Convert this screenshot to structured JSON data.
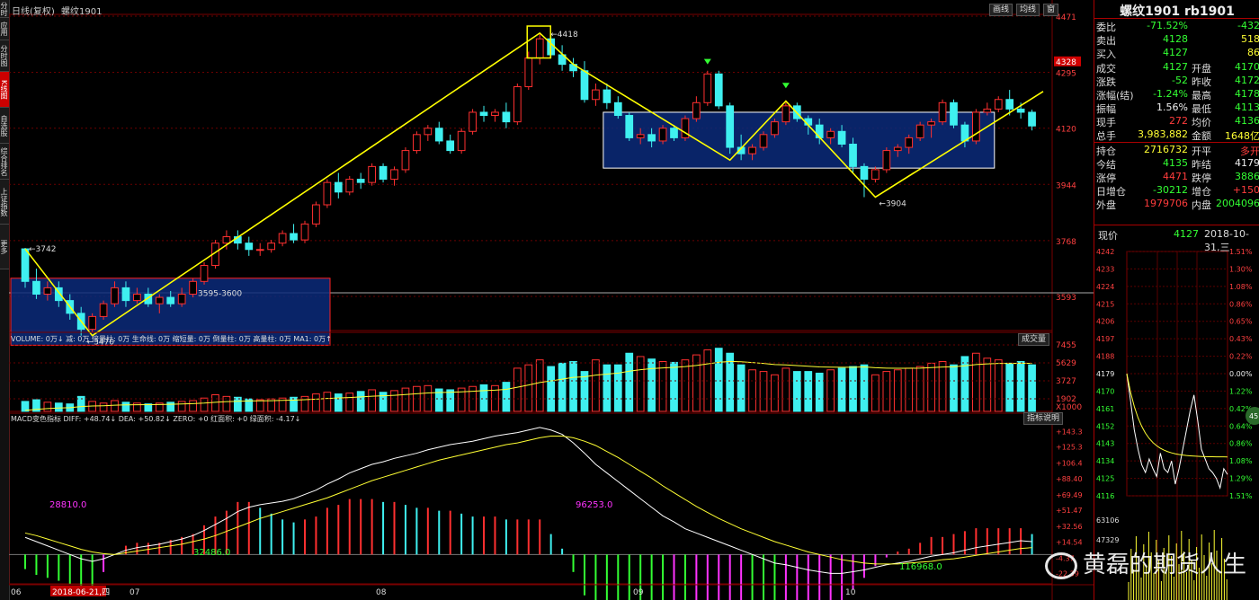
{
  "app": {
    "left_tabs": [
      "分时图",
      "应用",
      "分时图",
      "K线图",
      "自选股",
      "综合排名",
      "上证指数",
      "更多"
    ],
    "chart_title": "日线(复权)",
    "symbol_name": "螺纹1901",
    "top_buttons": [
      "画线",
      "均线",
      "窗"
    ],
    "volume_button": "成交量",
    "macd_button": "指标说明"
  },
  "info": {
    "title": "螺纹1901 rb1901",
    "rows": [
      {
        "l": "委比",
        "v": "-71.52%",
        "vc": "green",
        "l2": "",
        "v2": "-432",
        "v2c": "green"
      },
      {
        "l": "卖出",
        "v": "4128",
        "vc": "green",
        "l2": "",
        "v2": "518",
        "v2c": "yellow"
      },
      {
        "l": "买入",
        "v": "4127",
        "vc": "green",
        "l2": "",
        "v2": "86",
        "v2c": "yellow"
      },
      {
        "l": "成交",
        "v": "4127",
        "vc": "green",
        "l2": "开盘",
        "v2": "4170",
        "v2c": "green"
      },
      {
        "l": "涨跌",
        "v": "-52",
        "vc": "green",
        "l2": "昨收",
        "v2": "4172",
        "v2c": "green"
      },
      {
        "l": "涨幅(结)",
        "v": "-1.24%",
        "vc": "green",
        "l2": "最高",
        "v2": "4178",
        "v2c": "green"
      },
      {
        "l": "振幅",
        "v": "1.56%",
        "vc": "white",
        "l2": "最低",
        "v2": "4113",
        "v2c": "green"
      },
      {
        "l": "现手",
        "v": "272",
        "vc": "red",
        "l2": "均价",
        "v2": "4136",
        "v2c": "green"
      },
      {
        "l": "总手",
        "v": "3,983,882",
        "vc": "yellow",
        "l2": "金额",
        "v2": "1648亿",
        "v2c": "yellow"
      },
      {
        "l": "持仓",
        "v": "2716732",
        "vc": "yellow",
        "l2": "开平",
        "v2": "多开",
        "v2c": "red"
      },
      {
        "l": "今结",
        "v": "4135",
        "vc": "green",
        "l2": "昨结",
        "v2": "4179",
        "v2c": "white"
      },
      {
        "l": "涨停",
        "v": "4471",
        "vc": "red",
        "l2": "跌停",
        "v2": "3886",
        "v2c": "green"
      },
      {
        "l": "日增仓",
        "v": "-30212",
        "vc": "green",
        "l2": "增仓",
        "v2": "+150",
        "v2c": "red"
      },
      {
        "l": "外盘",
        "v": "1979706",
        "vc": "red",
        "l2": "内盘",
        "v2": "2004096",
        "v2c": "green"
      }
    ],
    "xianjia_label": "现价",
    "xianjia_value": "4127",
    "date_label": "2018-10-31,三",
    "minute_left_ticks": [
      "4242",
      "4233",
      "4224",
      "4215",
      "4206",
      "4197",
      "4188",
      "4179",
      "4170",
      "4161",
      "4152",
      "4143",
      "4134",
      "4125",
      "4116"
    ],
    "minute_right_ticks": [
      "1.51%",
      "1.30%",
      "1.08%",
      "0.86%",
      "0.65%",
      "0.43%",
      "0.22%",
      "0.00%",
      "1.22%",
      "0.42%",
      "0.64%",
      "0.86%",
      "1.08%",
      "1.29%",
      "1.51%"
    ],
    "minute_vol_ticks": [
      "63106",
      "47329"
    ],
    "minute_badge": "45"
  },
  "chart_data": {
    "type": "candlestick",
    "price_axis_ticks": [
      "4471",
      "4295",
      "4120",
      "3944",
      "3768",
      "3593"
    ],
    "price_tag": "4328",
    "annotations": {
      "low1": "3742",
      "low2": "3470",
      "high": "4418",
      "low3": "3904",
      "zone": "3595-3600"
    },
    "x_labels": [
      "06",
      "2018-06-21,四",
      "07",
      "08",
      "09",
      "10"
    ],
    "candles": [
      [
        3742,
        3745,
        3620,
        3640
      ],
      [
        3640,
        3680,
        3585,
        3600
      ],
      [
        3600,
        3640,
        3580,
        3620
      ],
      [
        3620,
        3640,
        3560,
        3580
      ],
      [
        3580,
        3600,
        3520,
        3540
      ],
      [
        3540,
        3560,
        3470,
        3490
      ],
      [
        3490,
        3540,
        3480,
        3530
      ],
      [
        3530,
        3580,
        3520,
        3570
      ],
      [
        3570,
        3640,
        3560,
        3620
      ],
      [
        3620,
        3640,
        3560,
        3580
      ],
      [
        3580,
        3620,
        3570,
        3600
      ],
      [
        3600,
        3620,
        3560,
        3570
      ],
      [
        3570,
        3600,
        3540,
        3590
      ],
      [
        3590,
        3610,
        3560,
        3570
      ],
      [
        3570,
        3620,
        3560,
        3600
      ],
      [
        3600,
        3650,
        3590,
        3640
      ],
      [
        3640,
        3700,
        3630,
        3690
      ],
      [
        3690,
        3770,
        3680,
        3760
      ],
      [
        3760,
        3800,
        3740,
        3780
      ],
      [
        3780,
        3800,
        3740,
        3760
      ],
      [
        3760,
        3780,
        3720,
        3740
      ],
      [
        3740,
        3760,
        3720,
        3740
      ],
      [
        3740,
        3770,
        3730,
        3760
      ],
      [
        3760,
        3800,
        3750,
        3790
      ],
      [
        3790,
        3820,
        3760,
        3770
      ],
      [
        3770,
        3830,
        3760,
        3820
      ],
      [
        3820,
        3890,
        3810,
        3880
      ],
      [
        3880,
        3960,
        3870,
        3950
      ],
      [
        3950,
        3980,
        3900,
        3920
      ],
      [
        3920,
        3970,
        3910,
        3960
      ],
      [
        3960,
        3980,
        3930,
        3950
      ],
      [
        3950,
        4010,
        3940,
        4000
      ],
      [
        4000,
        4010,
        3950,
        3960
      ],
      [
        3960,
        4000,
        3940,
        3990
      ],
      [
        3990,
        4060,
        3980,
        4050
      ],
      [
        4050,
        4110,
        4040,
        4100
      ],
      [
        4100,
        4130,
        4080,
        4120
      ],
      [
        4120,
        4140,
        4070,
        4080
      ],
      [
        4080,
        4100,
        4040,
        4050
      ],
      [
        4050,
        4120,
        4040,
        4110
      ],
      [
        4110,
        4180,
        4100,
        4170
      ],
      [
        4170,
        4190,
        4140,
        4160
      ],
      [
        4160,
        4180,
        4140,
        4170
      ],
      [
        4170,
        4200,
        4120,
        4140
      ],
      [
        4140,
        4260,
        4130,
        4250
      ],
      [
        4250,
        4360,
        4240,
        4340
      ],
      [
        4340,
        4418,
        4320,
        4400
      ],
      [
        4400,
        4410,
        4340,
        4350
      ],
      [
        4350,
        4380,
        4300,
        4320
      ],
      [
        4320,
        4340,
        4280,
        4300
      ],
      [
        4300,
        4330,
        4200,
        4210
      ],
      [
        4210,
        4260,
        4190,
        4240
      ],
      [
        4240,
        4260,
        4180,
        4200
      ],
      [
        4200,
        4220,
        4150,
        4160
      ],
      [
        4160,
        4170,
        4080,
        4090
      ],
      [
        4090,
        4120,
        4070,
        4100
      ],
      [
        4100,
        4120,
        4060,
        4080
      ],
      [
        4080,
        4130,
        4070,
        4120
      ],
      [
        4120,
        4130,
        4080,
        4090
      ],
      [
        4090,
        4160,
        4080,
        4150
      ],
      [
        4150,
        4220,
        4140,
        4200
      ],
      [
        4200,
        4300,
        4190,
        4290
      ],
      [
        4290,
        4300,
        4180,
        4190
      ],
      [
        4190,
        4200,
        4040,
        4060
      ],
      [
        4060,
        4100,
        4020,
        4040
      ],
      [
        4040,
        4070,
        4020,
        4060
      ],
      [
        4060,
        4110,
        4050,
        4100
      ],
      [
        4100,
        4150,
        4090,
        4140
      ],
      [
        4140,
        4200,
        4130,
        4190
      ],
      [
        4190,
        4200,
        4140,
        4150
      ],
      [
        4150,
        4160,
        4100,
        4130
      ],
      [
        4130,
        4150,
        4070,
        4090
      ],
      [
        4090,
        4120,
        4070,
        4110
      ],
      [
        4110,
        4130,
        4060,
        4070
      ],
      [
        4070,
        4090,
        3980,
        4000
      ],
      [
        4000,
        4010,
        3904,
        3960
      ],
      [
        3960,
        4000,
        3950,
        3990
      ],
      [
        3990,
        4060,
        3980,
        4050
      ],
      [
        4050,
        4070,
        4030,
        4060
      ],
      [
        4060,
        4100,
        4040,
        4090
      ],
      [
        4090,
        4140,
        4080,
        4130
      ],
      [
        4130,
        4150,
        4090,
        4140
      ],
      [
        4140,
        4210,
        4130,
        4200
      ],
      [
        4200,
        4210,
        4120,
        4130
      ],
      [
        4130,
        4140,
        4060,
        4080
      ],
      [
        4080,
        4180,
        4070,
        4170
      ],
      [
        4170,
        4200,
        4160,
        4180
      ],
      [
        4180,
        4220,
        4170,
        4210
      ],
      [
        4210,
        4240,
        4160,
        4180
      ],
      [
        4180,
        4200,
        4150,
        4170
      ],
      [
        4170,
        4178,
        4113,
        4127
      ]
    ],
    "volume_legend": "VOLUME: 0万↓ 减: 0万 倍量柱: 0万 生命线: 0万 缩短量: 0万 倒量柱: 0万 高量柱: 0万 MA1: 0万↑",
    "volume_ticks": [
      "7455",
      "5629",
      "3727",
      "1902",
      "X1000"
    ],
    "volume_values": [
      120,
      140,
      110,
      100,
      90,
      180,
      120,
      100,
      130,
      110,
      100,
      90,
      100,
      110,
      120,
      130,
      160,
      200,
      180,
      170,
      150,
      140,
      150,
      160,
      170,
      180,
      210,
      230,
      210,
      220,
      240,
      260,
      230,
      250,
      280,
      300,
      310,
      270,
      260,
      280,
      300,
      320,
      310,
      350,
      520,
      560,
      620,
      540,
      580,
      600,
      480,
      620,
      560,
      560,
      700,
      660,
      630,
      600,
      590,
      620,
      680,
      740,
      760,
      700,
      560,
      500,
      480,
      440,
      520,
      480,
      480,
      460,
      500,
      520,
      540,
      560,
      440,
      480,
      500,
      520,
      540,
      580,
      600,
      560,
      660,
      700,
      640,
      620,
      580,
      600,
      560
    ],
    "macd_legend": "MACD变色指标 DIFF: +48.74↓ DEA: +50.82↓ ZERO: +0 红面积: +0 绿面积: -4.17↓",
    "macd_ticks": [
      "+143.3",
      "+125.3",
      "+106.4",
      "+88.40",
      "+69.49",
      "+51.47",
      "+32.56",
      "+14.54",
      "-4.37",
      "-22.39"
    ],
    "macd_area_labels": [
      "28810.0",
      "32486.0",
      "96253.0",
      "116968.0"
    ],
    "macd_diff": [
      20,
      15,
      10,
      5,
      0,
      -5,
      -8,
      -5,
      0,
      5,
      8,
      10,
      12,
      15,
      18,
      22,
      28,
      35,
      42,
      50,
      55,
      58,
      60,
      62,
      65,
      70,
      75,
      82,
      88,
      95,
      100,
      105,
      108,
      112,
      115,
      118,
      122,
      125,
      128,
      130,
      132,
      135,
      138,
      140,
      142,
      145,
      148,
      145,
      140,
      130,
      118,
      105,
      95,
      85,
      75,
      65,
      55,
      45,
      38,
      30,
      25,
      20,
      15,
      10,
      5,
      0,
      -5,
      -10,
      -12,
      -15,
      -18,
      -20,
      -22,
      -22,
      -20,
      -18,
      -15,
      -12,
      -10,
      -8,
      -5,
      -2,
      0,
      2,
      5,
      8,
      10,
      12,
      14,
      16,
      15
    ],
    "macd_dea": [
      25,
      22,
      18,
      14,
      10,
      6,
      3,
      1,
      0,
      2,
      4,
      6,
      8,
      10,
      12,
      15,
      18,
      22,
      27,
      32,
      37,
      42,
      46,
      50,
      54,
      58,
      62,
      66,
      71,
      76,
      81,
      86,
      90,
      94,
      98,
      102,
      106,
      110,
      113,
      116,
      119,
      122,
      125,
      128,
      130,
      133,
      136,
      138,
      138,
      136,
      132,
      127,
      120,
      113,
      105,
      97,
      89,
      80,
      72,
      64,
      56,
      49,
      42,
      36,
      30,
      25,
      20,
      15,
      11,
      7,
      3,
      0,
      -3,
      -6,
      -8,
      -10,
      -11,
      -11,
      -11,
      -10,
      -9,
      -8,
      -6,
      -5,
      -3,
      -1,
      1,
      3,
      5,
      7,
      8
    ],
    "macd_hist": [
      -10,
      -14,
      -16,
      -18,
      -20,
      -22,
      -22,
      -12,
      0,
      6,
      8,
      8,
      8,
      10,
      12,
      14,
      20,
      26,
      30,
      36,
      36,
      32,
      28,
      24,
      22,
      24,
      26,
      32,
      34,
      38,
      38,
      38,
      36,
      36,
      34,
      32,
      32,
      30,
      30,
      28,
      26,
      26,
      26,
      24,
      24,
      24,
      24,
      14,
      4,
      -12,
      -28,
      -44,
      -50,
      -56,
      -60,
      -64,
      -68,
      -70,
      -68,
      -68,
      -62,
      -58,
      -54,
      -52,
      -50,
      -50,
      -50,
      -50,
      -46,
      -44,
      -42,
      -40,
      -38,
      -32,
      -24,
      -16,
      -8,
      -2,
      2,
      4,
      8,
      12,
      12,
      14,
      16,
      18,
      18,
      18,
      18,
      18,
      14
    ]
  },
  "watermark": "黄磊的期货人生"
}
